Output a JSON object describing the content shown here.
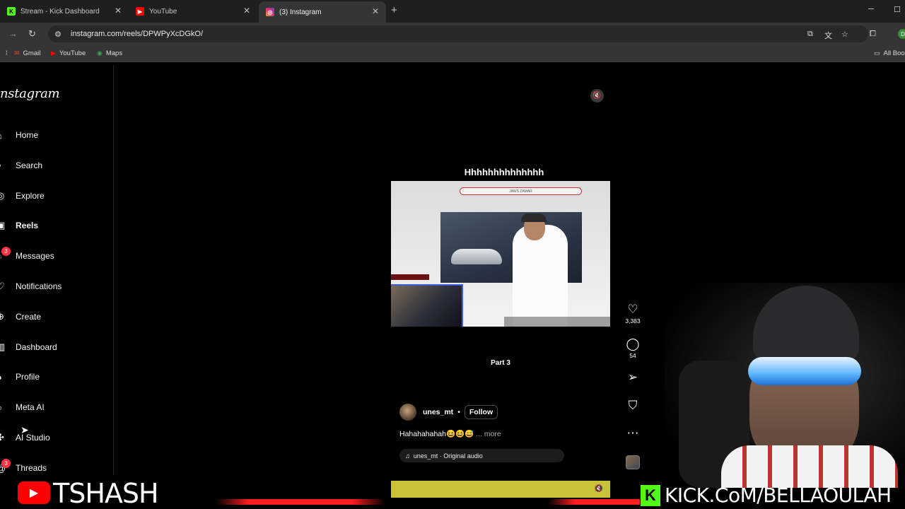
{
  "browser": {
    "tabs": [
      {
        "title": "Stream - Kick Dashboard",
        "icon": "kick-icon",
        "color": "#53fc18"
      },
      {
        "title": "YouTube",
        "icon": "youtube-icon",
        "color": "#ff0000"
      },
      {
        "title": "(3) Instagram",
        "icon": "instagram-icon",
        "color": "#e1306c"
      }
    ],
    "url": "instagram.com/reels/DPWPyXcDGkO/",
    "bookmarks": [
      {
        "label": "Gmail",
        "icon": "gmail-icon"
      },
      {
        "label": "YouTube",
        "icon": "youtube-icon"
      },
      {
        "label": "Maps",
        "icon": "maps-icon"
      }
    ],
    "all_bookmarks_label": "All Boo",
    "profile_initial": "D"
  },
  "instagram": {
    "logo": "nstagram",
    "nav": [
      {
        "label": "Home",
        "icon": "home-icon",
        "bold": false
      },
      {
        "label": "Search",
        "icon": "search-icon",
        "bold": false
      },
      {
        "label": "Explore",
        "icon": "compass-icon",
        "bold": false
      },
      {
        "label": "Reels",
        "icon": "reels-icon",
        "bold": true
      },
      {
        "label": "Messages",
        "icon": "messenger-icon",
        "bold": false,
        "badge": "3"
      },
      {
        "label": "Notifications",
        "icon": "heart-icon",
        "bold": false
      },
      {
        "label": "Create",
        "icon": "plus-icon",
        "bold": false
      },
      {
        "label": "Dashboard",
        "icon": "dashboard-icon",
        "bold": false
      },
      {
        "label": "Profile",
        "icon": "avatar-icon",
        "bold": false
      },
      {
        "label": "Meta AI",
        "icon": "meta-ai-icon",
        "bold": false
      },
      {
        "label": "AI Studio",
        "icon": "ai-studio-icon",
        "bold": false
      },
      {
        "label": "Threads",
        "icon": "threads-icon",
        "bold": false,
        "badge": "3"
      }
    ],
    "reel": {
      "overlay_text": "Hhhhhhhhhhhhhh",
      "video_hud_text": "JAWS ZAMAR",
      "part_text": "Part 3",
      "author": "unes_mt",
      "follow_label": "Follow",
      "caption": "Hahahahahah😆😆😅",
      "caption_more": "... more",
      "audio": "unes_mt · Original audio",
      "likes": "3,383",
      "comments": "54"
    }
  },
  "stream_overlay": {
    "youtube_name": "TSHASH",
    "kick_url": "KICK.CoM/BELLAOULAH",
    "youtube_color": "#ff0000",
    "kick_color": "#53fc18"
  }
}
